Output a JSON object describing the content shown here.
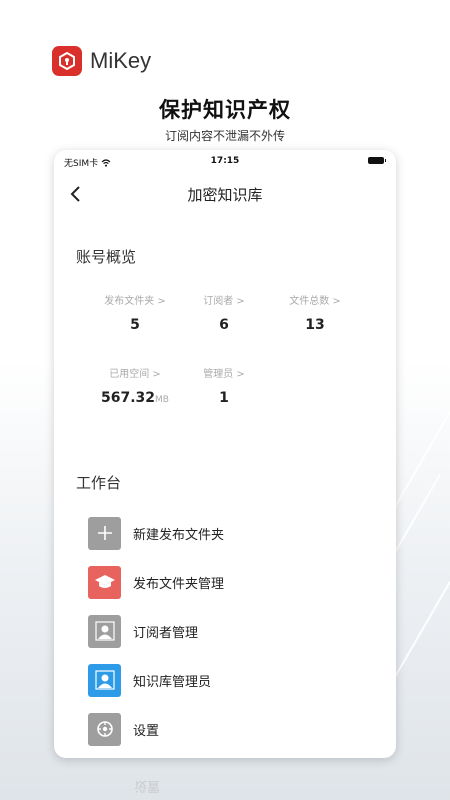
{
  "brand": {
    "name": "MiKey",
    "color": "#d9302c"
  },
  "hero": {
    "title": "保护知识产权",
    "subtitle": "订阅内容不泄漏不外传"
  },
  "status_bar": {
    "carrier": "无SIM卡",
    "time": "17:15"
  },
  "nav": {
    "title": "加密知识库",
    "back_icon": "chevron-left-icon"
  },
  "overview": {
    "title": "账号概览",
    "stats": [
      {
        "label": "发布文件夹 >",
        "value": "5",
        "unit": ""
      },
      {
        "label": "订阅者 >",
        "value": "6",
        "unit": ""
      },
      {
        "label": "文件总数 >",
        "value": "13",
        "unit": ""
      },
      {
        "label": "已用空间 >",
        "value": "567.32",
        "unit": "MB"
      },
      {
        "label": "管理员 >",
        "value": "1",
        "unit": ""
      }
    ]
  },
  "workbench": {
    "title": "工作台",
    "items": [
      {
        "label": "新建发布文件夹",
        "icon": "plus-icon",
        "color": "#9e9e9e"
      },
      {
        "label": "发布文件夹管理",
        "icon": "graduation-cap-icon",
        "color": "#e8625e"
      },
      {
        "label": "订阅者管理",
        "icon": "user-icon",
        "color": "#9e9e9e"
      },
      {
        "label": "知识库管理员",
        "icon": "user-icon",
        "color": "#2d9be8"
      },
      {
        "label": "设置",
        "icon": "settings-icon",
        "color": "#9e9e9e"
      }
    ]
  },
  "reflection_text": "设置"
}
